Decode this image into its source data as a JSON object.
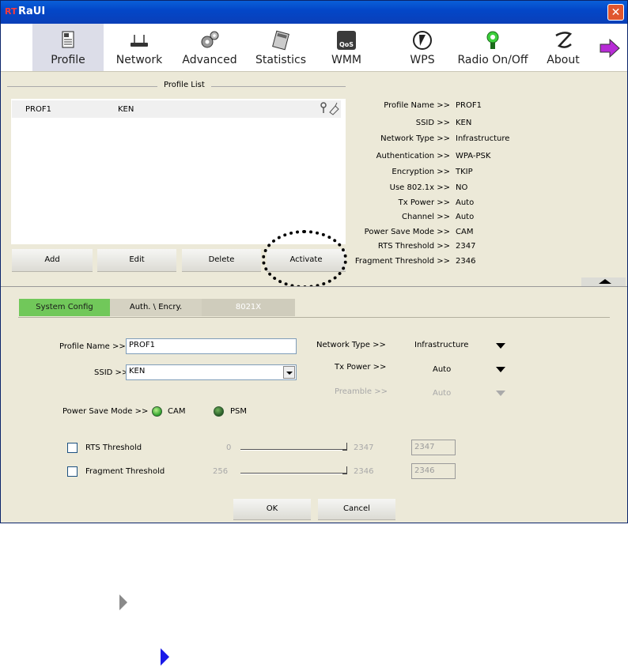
{
  "window": {
    "title": "RaUI",
    "logo": "RT",
    "close": "✕"
  },
  "toolbar": {
    "items": [
      {
        "label": "Profile",
        "icon": "profile-icon"
      },
      {
        "label": "Network",
        "icon": "network-icon"
      },
      {
        "label": "Advanced",
        "icon": "advanced-icon"
      },
      {
        "label": "Statistics",
        "icon": "statistics-icon"
      },
      {
        "label": "WMM",
        "icon": "qos-icon",
        "badge": "QoS"
      },
      {
        "label": "WPS",
        "icon": "wps-icon"
      },
      {
        "label": "Radio On/Off",
        "icon": "radio-icon"
      },
      {
        "label": "About",
        "icon": "about-icon"
      }
    ]
  },
  "profile_list": {
    "title": "Profile List",
    "rows": [
      {
        "name": "PROF1",
        "ssid": "KEN"
      }
    ]
  },
  "buttons": {
    "add": "Add",
    "edit": "Edit",
    "delete": "Delete",
    "activate": "Activate"
  },
  "info": [
    {
      "label": "Profile Name >>",
      "value": "PROF1"
    },
    {
      "label": "SSID >>",
      "value": "KEN"
    },
    {
      "label": "Network Type >>",
      "value": "Infrastructure"
    },
    {
      "label": "Authentication >>",
      "value": "WPA-PSK"
    },
    {
      "label": "Encryption >>",
      "value": "TKIP"
    },
    {
      "label": "Use 802.1x >>",
      "value": "NO"
    },
    {
      "label": "Tx Power >>",
      "value": "Auto"
    },
    {
      "label": "Channel >>",
      "value": "Auto"
    },
    {
      "label": "Power Save Mode >>",
      "value": "CAM"
    },
    {
      "label": "RTS Threshold >>",
      "value": "2347"
    },
    {
      "label": "Fragment Threshold >>",
      "value": "2346"
    }
  ],
  "tabs": [
    "System Config",
    "Auth. \\ Encry.",
    "8021X"
  ],
  "form": {
    "profile_name_label": "Profile Name >>",
    "profile_name_value": "PROF1",
    "ssid_label": "SSID >>",
    "ssid_value": "KEN",
    "network_type_label": "Network Type >>",
    "network_type_value": "Infrastructure",
    "tx_power_label": "Tx Power >>",
    "tx_power_value": "Auto",
    "preamble_label": "Preamble >>",
    "preamble_value": "Auto",
    "power_save_label": "Power Save Mode >>",
    "cam_label": "CAM",
    "psm_label": "PSM",
    "rts_label": "RTS Threshold",
    "rts_min": "0",
    "rts_max": "2347",
    "rts_value": "2347",
    "frag_label": "Fragment Threshold",
    "frag_min": "256",
    "frag_max": "2346",
    "frag_value": "2346",
    "ok": "OK",
    "cancel": "Cancel"
  },
  "colors": {
    "accent_tab": "#71c85a",
    "title_bar": "#0347c8",
    "arrow_blue": "#1a1ae8"
  }
}
